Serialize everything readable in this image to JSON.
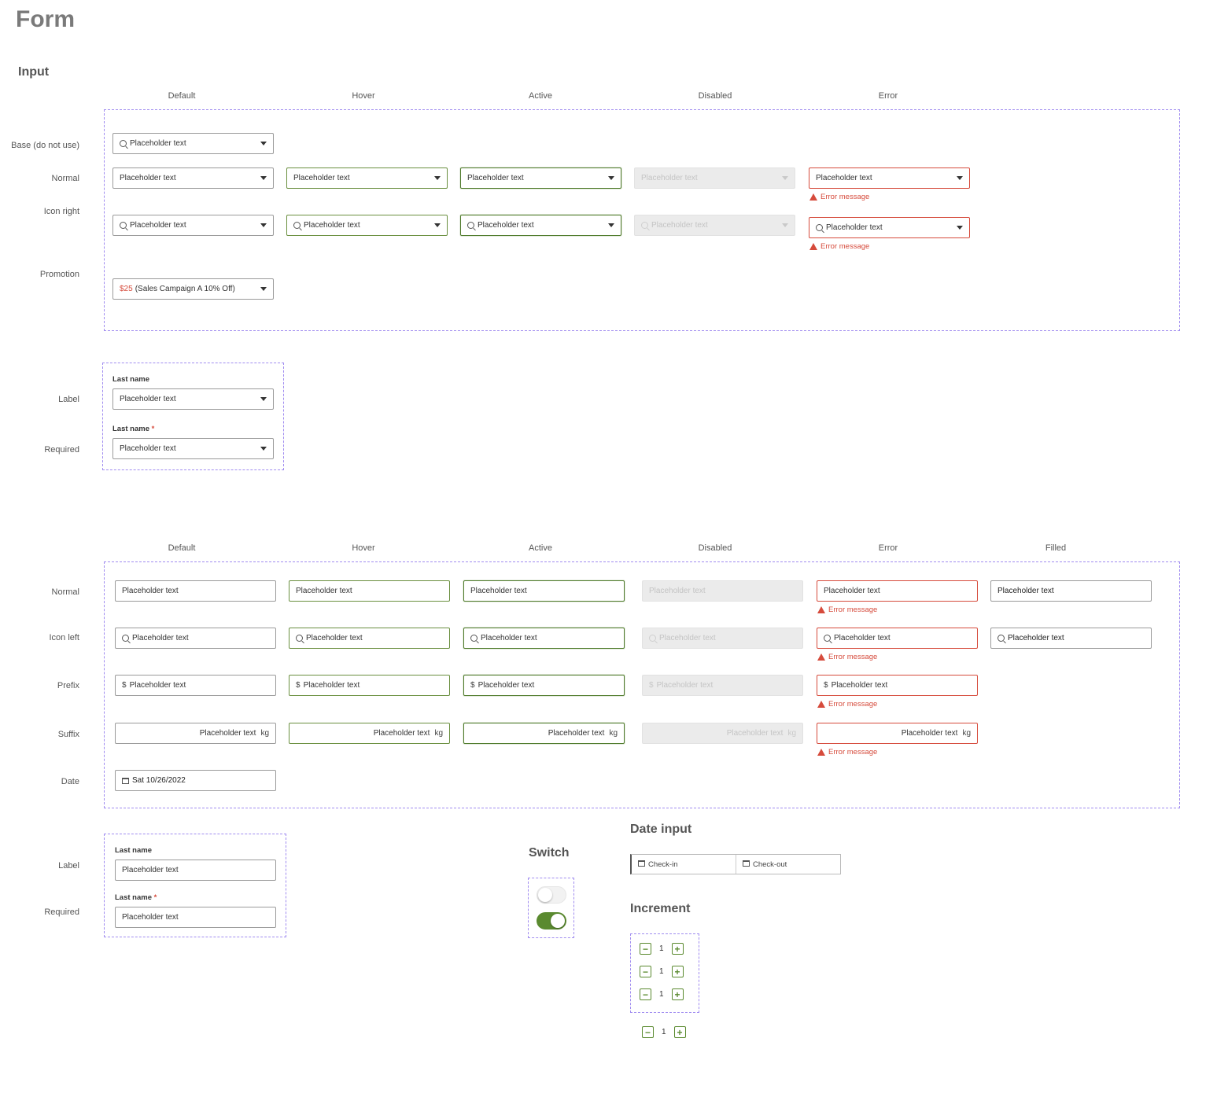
{
  "page_title": "Form",
  "input_section": {
    "title": "Input"
  },
  "states1": [
    "Default",
    "Hover",
    "Active",
    "Disabled",
    "Error"
  ],
  "states2": [
    "Default",
    "Hover",
    "Active",
    "Disabled",
    "Error",
    "Filled"
  ],
  "select_rows": {
    "base": "Base (do not use)",
    "normal": "Normal",
    "icon_right": "Icon right",
    "promotion": "Promotion",
    "label": "Label",
    "required": "Required"
  },
  "text_rows": {
    "normal": "Normal",
    "icon_left": "Icon left",
    "prefix": "Prefix",
    "suffix": "Suffix",
    "date": "Date",
    "label": "Label",
    "required": "Required"
  },
  "placeholder": "Placeholder text",
  "error_message": "Error message",
  "promotion": {
    "price": "$25",
    "text": "(Sales Campaign A 10% Off)"
  },
  "prefix_symbol": "$",
  "suffix_unit": "kg",
  "date_value": "Sat 10/26/2022",
  "field_label": "Last name",
  "required_mark": "*",
  "switch_section": {
    "title": "Switch",
    "states": [
      "off",
      "on"
    ]
  },
  "date_input": {
    "title": "Date input",
    "check_in": "Check-in",
    "check_out": "Check-out"
  },
  "increment": {
    "title": "Increment",
    "value": "1",
    "minus": "−",
    "plus": "+"
  },
  "colors": {
    "accent": "#5a8a2f",
    "error": "#d64b3c",
    "dashed": "#a08cf0"
  }
}
